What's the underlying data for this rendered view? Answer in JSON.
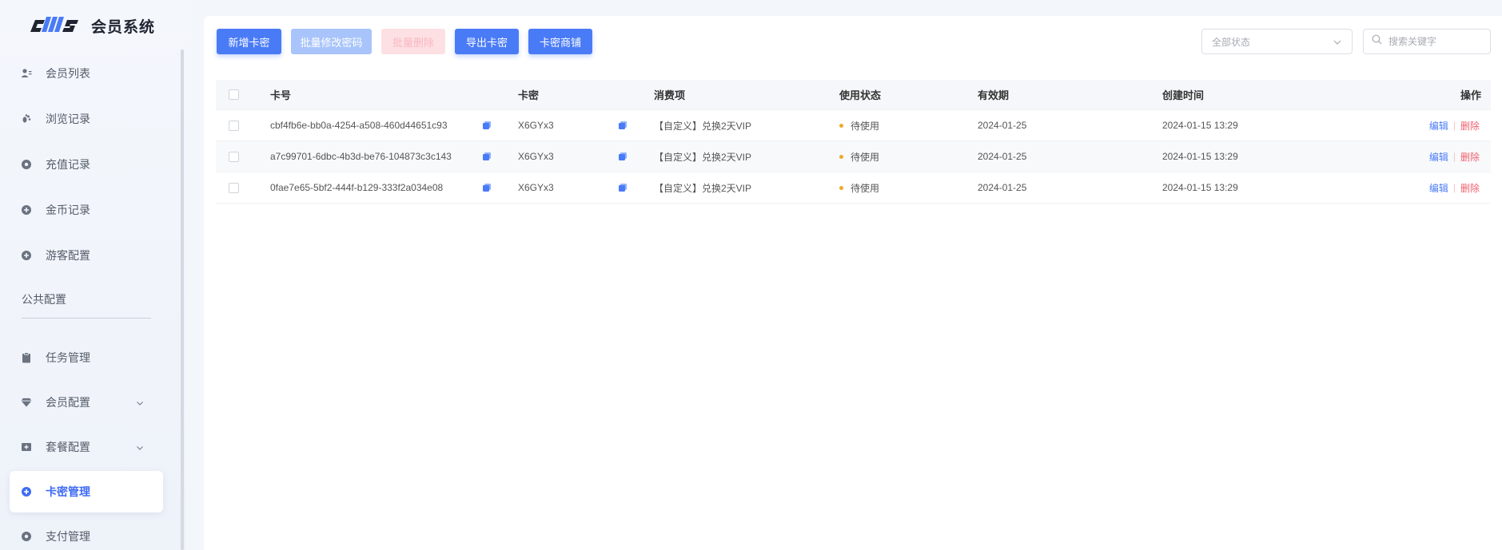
{
  "app": {
    "logo_text": "cms",
    "title": "会员系统"
  },
  "sidebar": {
    "items": [
      {
        "label": "会员列表",
        "icon": "user-list-icon"
      },
      {
        "label": "浏览记录",
        "icon": "footprint-icon"
      },
      {
        "label": "充值记录",
        "icon": "circle-dot-icon"
      },
      {
        "label": "金币记录",
        "icon": "circle-dot-icon"
      },
      {
        "label": "游客配置",
        "icon": "circle-dot-icon"
      }
    ],
    "section_title": "公共配置",
    "config_items": [
      {
        "label": "任务管理",
        "icon": "clipboard-icon"
      },
      {
        "label": "会员配置",
        "icon": "diamond-icon",
        "expandable": true
      },
      {
        "label": "套餐配置",
        "icon": "package-icon",
        "expandable": true
      },
      {
        "label": "卡密管理",
        "icon": "circle-dot-icon",
        "active": true
      },
      {
        "label": "支付管理",
        "icon": "circle-dot-icon"
      }
    ]
  },
  "toolbar": {
    "add_label": "新增卡密",
    "batch_edit_label": "批量修改密码",
    "batch_delete_label": "批量删除",
    "export_label": "导出卡密",
    "shop_label": "卡密商铺"
  },
  "filter": {
    "status_placeholder": "全部状态",
    "search_placeholder": "搜索关键字"
  },
  "table": {
    "headers": {
      "card_no": "卡号",
      "secret": "卡密",
      "consume": "消费项",
      "status": "使用状态",
      "expire": "有效期",
      "created": "创建时间",
      "actions": "操作"
    },
    "rows": [
      {
        "card_no": "cbf4fb6e-bb0a-4254-a508-460d44651c93",
        "secret": "X6GYx3",
        "consume": "【自定义】兑换2天VIP",
        "status": "待使用",
        "expire": "2024-01-25",
        "created": "2024-01-15 13:29",
        "edit": "编辑",
        "delete": "删除"
      },
      {
        "card_no": "a7c99701-6dbc-4b3d-be76-104873c3c143",
        "secret": "X6GYx3",
        "consume": "【自定义】兑换2天VIP",
        "status": "待使用",
        "expire": "2024-01-25",
        "created": "2024-01-15 13:29",
        "edit": "编辑",
        "delete": "删除"
      },
      {
        "card_no": "0fae7e65-5bf2-444f-b129-333f2a034e08",
        "secret": "X6GYx3",
        "consume": "【自定义】兑换2天VIP",
        "status": "待使用",
        "expire": "2024-01-25",
        "created": "2024-01-15 13:29",
        "edit": "编辑",
        "delete": "删除"
      }
    ]
  },
  "colors": {
    "primary": "#4a7bf7",
    "status_pending": "#f0a82a",
    "danger": "#f0616f"
  }
}
